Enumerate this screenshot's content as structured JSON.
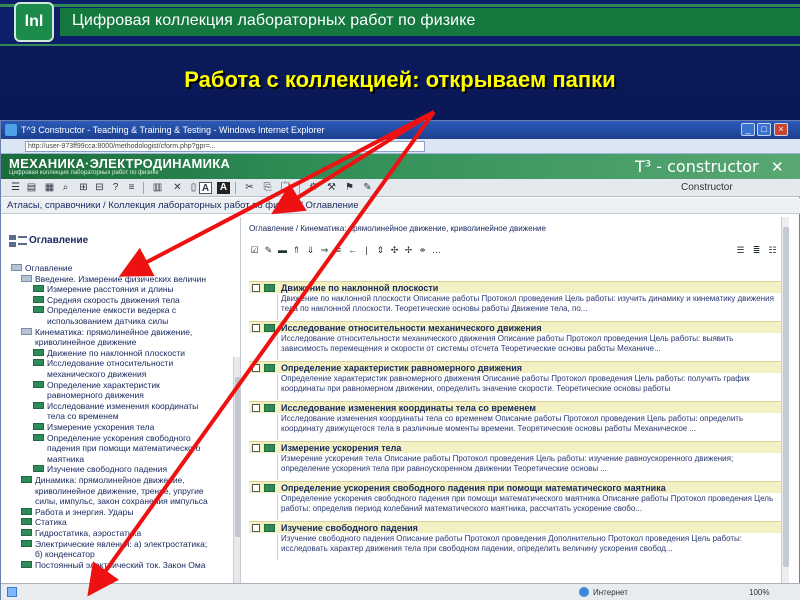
{
  "slide": {
    "header": "Цифровая коллекция лабораторных работ по физике",
    "subtitle": "Работа с коллекцией: открываем папки",
    "logo": "lnl"
  },
  "browser": {
    "title": "T^3 Constructor - Teaching & Training & Testing - Windows Internet Explorer",
    "address": "http://user-973ff99cca:8000/methodologist/cform.php?gpr=...",
    "status_zone": "Интернет",
    "zoom": "100%"
  },
  "app": {
    "logo_main": "МЕХАНИКА·ЭЛЕКТРОДИНАМИКА",
    "logo_sub": "Цифровая коллекция лабораторных работ по физике",
    "constructor_logo": "T³ - constructor",
    "mode_label": "Constructor",
    "breadcrumb": "Атласы, справочники / Коллекция лабораторных работ по физике  / Оглавление"
  },
  "left_panel": {
    "title": "Оглавление",
    "tree": [
      {
        "label": "Оглавление",
        "kind": "folder",
        "level": 0
      },
      {
        "label": "Введение. Измерение физических величин",
        "kind": "folder",
        "level": 1
      },
      {
        "label": "Измерение расстояния и длины",
        "kind": "item",
        "level": 2
      },
      {
        "label": "Средняя скорость движения тела",
        "kind": "item",
        "level": 2
      },
      {
        "label": "Определение емкости ведерка с",
        "kind": "item",
        "level": 2
      },
      {
        "label": "использованием датчика силы",
        "kind": "cont",
        "level": 2
      },
      {
        "label": "Кинематика: прямолинейное движение,",
        "kind": "folder",
        "level": 1
      },
      {
        "label": "криволинейное движение",
        "kind": "cont",
        "level": 1
      },
      {
        "label": "Движение по наклонной плоскости",
        "kind": "item",
        "level": 2
      },
      {
        "label": "Исследование относительности",
        "kind": "item",
        "level": 2
      },
      {
        "label": "механического движения",
        "kind": "cont",
        "level": 2
      },
      {
        "label": "Определение характеристик",
        "kind": "item",
        "level": 2
      },
      {
        "label": "равномерного движения",
        "kind": "cont",
        "level": 2
      },
      {
        "label": "Исследование изменения координаты",
        "kind": "item",
        "level": 2
      },
      {
        "label": "тела со временем",
        "kind": "cont",
        "level": 2
      },
      {
        "label": "Измерение ускорения тела",
        "kind": "item",
        "level": 2
      },
      {
        "label": "Определение ускорения свободного",
        "kind": "item",
        "level": 2
      },
      {
        "label": "падения при помощи математического",
        "kind": "cont",
        "level": 2
      },
      {
        "label": "маятника",
        "kind": "cont",
        "level": 2
      },
      {
        "label": "Изучение свободного падения",
        "kind": "item",
        "level": 2
      },
      {
        "label": "Динамика: прямолинейное движение,",
        "kind": "item",
        "level": 1
      },
      {
        "label": "криволинейное движение, трение, упругие",
        "kind": "cont",
        "level": 1
      },
      {
        "label": "силы, импульс, закон сохранения импульса",
        "kind": "cont",
        "level": 1
      },
      {
        "label": "Работа и энергия. Удары",
        "kind": "item",
        "level": 1
      },
      {
        "label": "Статика",
        "kind": "item",
        "level": 1
      },
      {
        "label": "Гидростатика, аэростатика",
        "kind": "item",
        "level": 1
      },
      {
        "label": "Электрические явления: а) электростатика;",
        "kind": "item",
        "level": 1
      },
      {
        "label": "б) конденсатор",
        "kind": "cont",
        "level": 1
      },
      {
        "label": "Постоянный электрический ток. Закон Ома",
        "kind": "item",
        "level": 1
      }
    ]
  },
  "right_panel": {
    "breadcrumb": "Оглавление / Кинематика: прямолинейное движение, криволинейное движение",
    "items": [
      {
        "title": "Движение по наклонной плоскости",
        "desc": "Движение по наклонной плоскости Описание работы Протокол проведения Цель работы: изучить динамику и кинематику движения тела по наклонной плоскости. Теоретические основы работы Движение тела, по..."
      },
      {
        "title": "Исследование относительности механического движения",
        "desc": "Исследование относительности механического движения Описание работы Протокол проведения Цель работы: выявить зависимость перемещения и скорости от системы отсчета Теоретические основы работы Механиче..."
      },
      {
        "title": "Определение характеристик равномерного движения",
        "desc": "Определение характеристик равномерного движения Описание работы Протокол проведения Цель работы: получить график координаты при равномерном движении, определить значение скорости. Теоретические основы работы"
      },
      {
        "title": "Исследование изменения координаты тела со временем",
        "desc": "Исследование изменения координаты тела со временем Описание работы Протокол проведения Цель работы: определить координату движущегося тела в различные моменты времени. Теоретические основы работы Механическое ..."
      },
      {
        "title": "Измерение ускорения тела",
        "desc": "Измерение ускорения тела Описание работы Протокол проведения Цель работы: изучение равноускоренного движения; определение ускорения тела при равноускоренном движении Теоретические основы ..."
      },
      {
        "title": "Определение ускорения свободного падения при помощи математического маятника",
        "desc": "Определение ускорения свободного падения при помощи математического маятника Описание работы Протокол проведения Цель работы: определив период колебаний математического маятника, рассчитать ускорение свобо..."
      },
      {
        "title": "Изучение свободного падения",
        "desc": "Изучение свободного падения Описание работы Протокол проведения Дополнительно Протокол проведения Цель работы: исследовать характер движения тела при свободном падении, определить величину ускорения свобод..."
      }
    ]
  },
  "colors": {
    "slide_bg": "#0b1a55",
    "accent_green": "#14783f",
    "subtitle_yellow": "#ffff00",
    "arrow_red": "#ee1111",
    "item_title_bg": "#f3f0c4"
  }
}
